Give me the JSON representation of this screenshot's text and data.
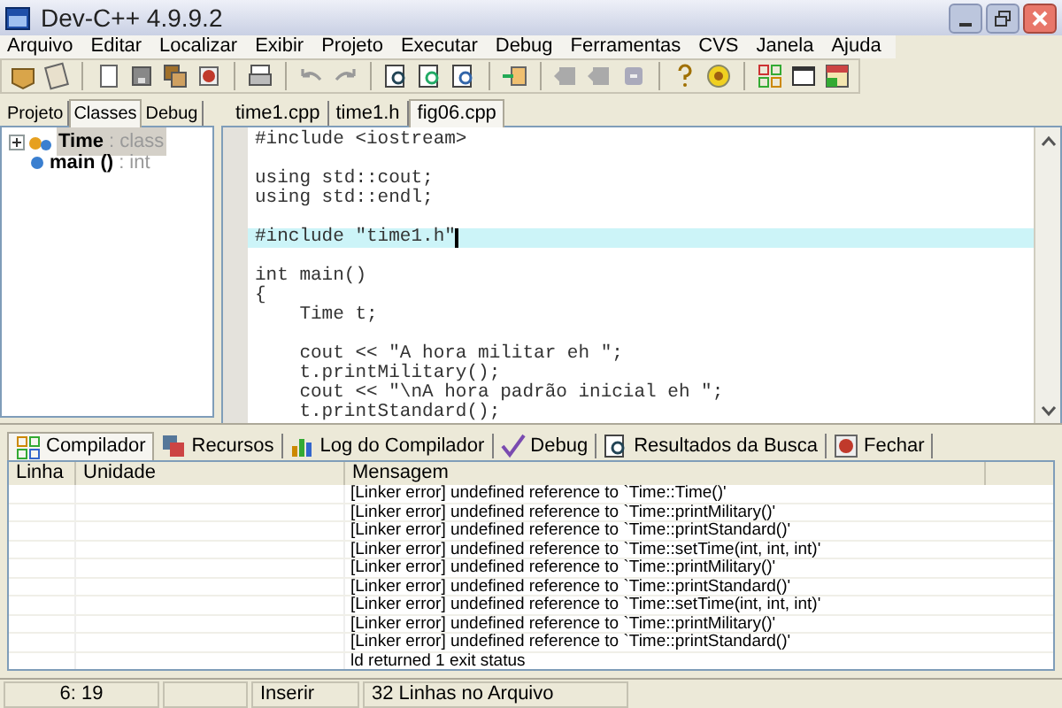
{
  "window": {
    "title": "Dev-C++ 4.9.9.2"
  },
  "menu": [
    "Arquivo",
    "Editar",
    "Localizar",
    "Exibir",
    "Projeto",
    "Executar",
    "Debug",
    "Ferramentas",
    "CVS",
    "Janela",
    "Ajuda"
  ],
  "side_tabs": [
    {
      "label": "Projeto",
      "selected": false
    },
    {
      "label": "Classes",
      "selected": true
    },
    {
      "label": "Debug",
      "selected": false
    }
  ],
  "class_tree": [
    {
      "name": "Time",
      "type": ": class",
      "selected": true,
      "expanded": false
    },
    {
      "name": "main ()",
      "type": ": int",
      "selected": false
    }
  ],
  "file_tabs": [
    {
      "label": "time1.cpp",
      "selected": false
    },
    {
      "label": "time1.h",
      "selected": false
    },
    {
      "label": "fig06.cpp",
      "selected": true
    }
  ],
  "editor": {
    "lines": [
      {
        "kind": "code",
        "text": "#include <iostream>"
      },
      {
        "kind": "blank"
      },
      {
        "kind": "code",
        "text": "using std::cout;"
      },
      {
        "kind": "code",
        "text": "using std::endl;"
      },
      {
        "kind": "blank"
      },
      {
        "kind": "code",
        "text": "#include \"time1.h\"",
        "highlighted": true
      },
      {
        "kind": "blank"
      },
      {
        "kind": "code",
        "text": "int main()"
      },
      {
        "kind": "code",
        "text": "{"
      },
      {
        "kind": "code",
        "text": "    Time t;"
      },
      {
        "kind": "blank"
      },
      {
        "kind": "code",
        "text": "    cout << \"A hora militar eh \";"
      },
      {
        "kind": "code",
        "text": "    t.printMilitary();"
      },
      {
        "kind": "code",
        "text": "    cout << \"\\nA hora padrão inicial eh \";"
      },
      {
        "kind": "code",
        "text": "    t.printStandard();"
      }
    ]
  },
  "bottom_tabs": [
    {
      "label": "Compilador",
      "selected": true
    },
    {
      "label": "Recursos",
      "selected": false
    },
    {
      "label": "Log do Compilador",
      "selected": false
    },
    {
      "label": "Debug",
      "selected": false
    },
    {
      "label": "Resultados da Busca",
      "selected": false
    },
    {
      "label": "Fechar",
      "selected": false
    }
  ],
  "table": {
    "columns": [
      "Linha",
      "Unidade",
      "Mensagem"
    ],
    "rows": [
      "[Linker error] undefined reference to `Time::Time()'",
      "[Linker error] undefined reference to `Time::printMilitary()'",
      "[Linker error] undefined reference to `Time::printStandard()'",
      "[Linker error] undefined reference to `Time::setTime(int, int, int)'",
      "[Linker error] undefined reference to `Time::printMilitary()'",
      "[Linker error] undefined reference to `Time::printStandard()'",
      "[Linker error] undefined reference to `Time::setTime(int, int, int)'",
      "[Linker error] undefined reference to `Time::printMilitary()'",
      "[Linker error] undefined reference to `Time::printStandard()'",
      "ld returned 1 exit status"
    ]
  },
  "status_bar": {
    "position": "6: 19",
    "mode": "Inserir",
    "info": "32 Linhas no Arquivo"
  }
}
